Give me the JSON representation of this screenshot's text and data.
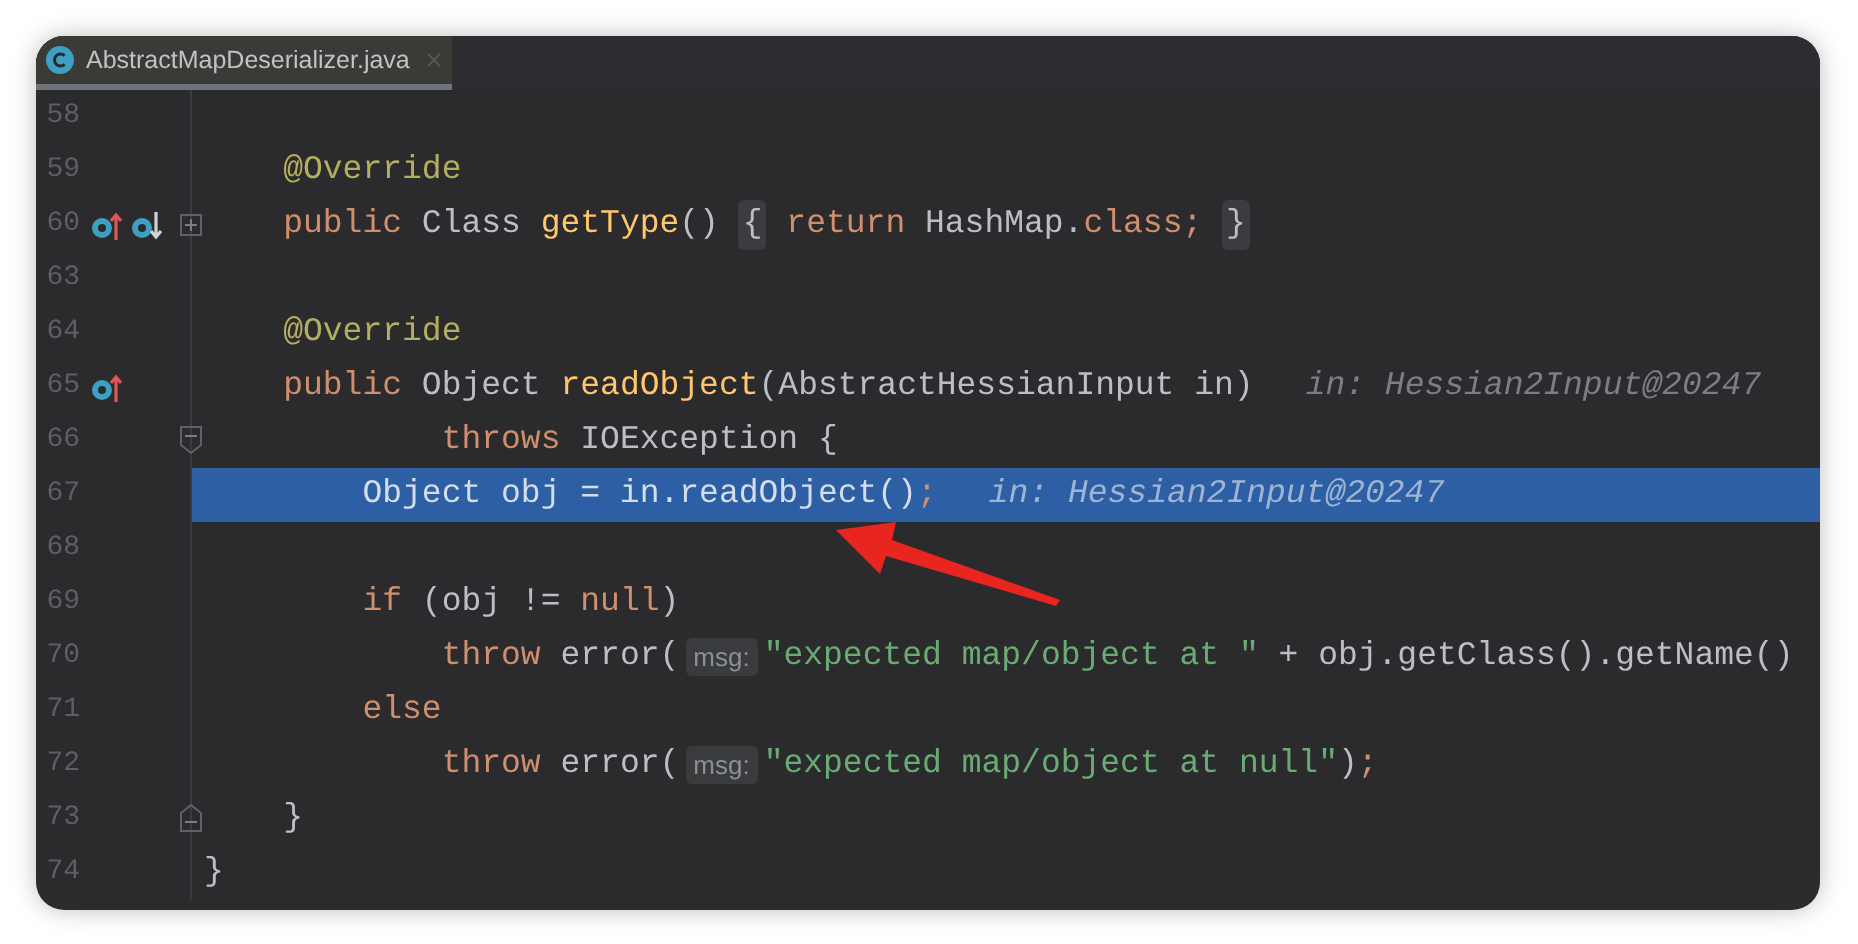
{
  "tab": {
    "title": "AbstractMapDeserializer.java",
    "selected": true
  },
  "lines": [
    {
      "number": "58",
      "selected": false
    },
    {
      "number": "59",
      "selected": false,
      "tokens": [
        {
          "kind": "annotation",
          "text": "    @Override"
        }
      ]
    },
    {
      "number": "60",
      "selected": false,
      "gutter": [
        {
          "kind": "overrides"
        },
        {
          "kind": "implemented"
        }
      ],
      "fold": {
        "kind": "expand"
      },
      "tokens": [
        {
          "kind": "keyword",
          "text": "    public "
        },
        {
          "kind": "plain",
          "text": "Class "
        },
        {
          "kind": "method",
          "text": "getType"
        },
        {
          "kind": "plain",
          "text": "() "
        },
        {
          "kind": "folded",
          "text": "{"
        },
        {
          "kind": "keyword",
          "text": " return "
        },
        {
          "kind": "plain",
          "text": "HashMap."
        },
        {
          "kind": "keyword",
          "text": "class; "
        },
        {
          "kind": "folded",
          "text": "}"
        }
      ]
    },
    {
      "number": "63",
      "selected": false
    },
    {
      "number": "64",
      "selected": false,
      "tokens": [
        {
          "kind": "annotation",
          "text": "    @Override"
        }
      ]
    },
    {
      "number": "65",
      "selected": false,
      "gutter": [
        {
          "kind": "overrides"
        }
      ],
      "tokens": [
        {
          "kind": "keyword",
          "text": "    public "
        },
        {
          "kind": "plain",
          "text": "Object "
        },
        {
          "kind": "method",
          "text": "readObject"
        },
        {
          "kind": "plain",
          "text": "(AbstractHessianInput in)"
        },
        {
          "kind": "hint",
          "text": "in: Hessian2Input@20247"
        }
      ]
    },
    {
      "number": "66",
      "selected": false,
      "fold": {
        "kind": "start"
      },
      "tokens": [
        {
          "kind": "keyword",
          "text": "            throws "
        },
        {
          "kind": "plain",
          "text": "IOException {"
        }
      ]
    },
    {
      "number": "67",
      "selected": true,
      "tokens": [
        {
          "kind": "plain",
          "text": "        Object obj = in.readObject()"
        },
        {
          "kind": "keyword",
          "text": ";"
        },
        {
          "kind": "hint",
          "text": "in: Hessian2Input@20247"
        }
      ]
    },
    {
      "number": "68",
      "selected": false
    },
    {
      "number": "69",
      "selected": false,
      "tokens": [
        {
          "kind": "keyword",
          "text": "        if "
        },
        {
          "kind": "plain",
          "text": "(obj != "
        },
        {
          "kind": "keyword",
          "text": "null"
        },
        {
          "kind": "plain",
          "text": ")"
        }
      ]
    },
    {
      "number": "70",
      "selected": false,
      "tokens": [
        {
          "kind": "keyword",
          "text": "            throw "
        },
        {
          "kind": "plain",
          "text": "error("
        },
        {
          "kind": "inlay",
          "text": "msg:"
        },
        {
          "kind": "string",
          "text": "\"expected map/object at \""
        },
        {
          "kind": "plain",
          "text": " + obj.getClass().getName()"
        }
      ]
    },
    {
      "number": "71",
      "selected": false,
      "tokens": [
        {
          "kind": "keyword",
          "text": "        else"
        }
      ]
    },
    {
      "number": "72",
      "selected": false,
      "tokens": [
        {
          "kind": "keyword",
          "text": "            throw "
        },
        {
          "kind": "plain",
          "text": "error("
        },
        {
          "kind": "inlay",
          "text": "msg:"
        },
        {
          "kind": "string",
          "text": "\"expected map/object at null\""
        },
        {
          "kind": "plain",
          "text": ")"
        },
        {
          "kind": "keyword",
          "text": ";"
        }
      ]
    },
    {
      "number": "73",
      "selected": false,
      "fold": {
        "kind": "end"
      },
      "tokens": [
        {
          "kind": "plain",
          "text": "    }"
        }
      ]
    },
    {
      "number": "74",
      "selected": false,
      "tokens": [
        {
          "kind": "plain",
          "text": "}"
        }
      ]
    }
  ]
}
